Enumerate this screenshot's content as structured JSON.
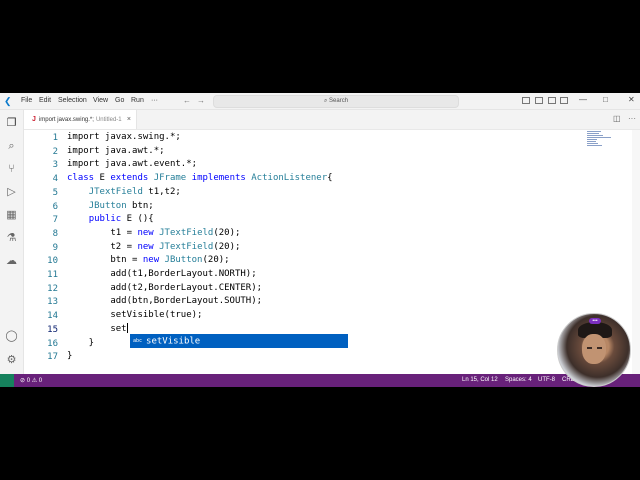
{
  "titlebar": {
    "menu": [
      "File",
      "Edit",
      "Selection",
      "View",
      "Go",
      "Run",
      "···"
    ],
    "nav_back": "←",
    "nav_forward": "→",
    "search_label": "Search",
    "window_controls": [
      "—",
      "□",
      "✕"
    ]
  },
  "tab": {
    "title": "import javax.swing.*;",
    "subtitle": "Untitled-1",
    "close": "×",
    "actions": [
      "◫",
      "···"
    ]
  },
  "editor": {
    "line_numbers": [
      "1",
      "2",
      "3",
      "4",
      "5",
      "6",
      "7",
      "8",
      "9",
      "10",
      "11",
      "12",
      "13",
      "14",
      "15",
      "16",
      "17"
    ],
    "lines": [
      [
        {
          "t": "import javax.swing.*;",
          "c": ""
        }
      ],
      [
        {
          "t": "import java.awt.*;",
          "c": ""
        }
      ],
      [
        {
          "t": "import java.awt.event.*;",
          "c": ""
        }
      ],
      [
        {
          "t": "class",
          "c": "kw"
        },
        {
          "t": " E ",
          "c": ""
        },
        {
          "t": "extends",
          "c": "kw"
        },
        {
          "t": " ",
          "c": ""
        },
        {
          "t": "JFrame",
          "c": "ty"
        },
        {
          "t": " ",
          "c": ""
        },
        {
          "t": "implements",
          "c": "kw"
        },
        {
          "t": " ",
          "c": ""
        },
        {
          "t": "ActionListener",
          "c": "ty"
        },
        {
          "t": "{",
          "c": ""
        }
      ],
      [
        {
          "t": "    ",
          "c": ""
        },
        {
          "t": "JTextField",
          "c": "ty"
        },
        {
          "t": " t1,t2;",
          "c": ""
        }
      ],
      [
        {
          "t": "    ",
          "c": ""
        },
        {
          "t": "JButton",
          "c": "ty"
        },
        {
          "t": " btn;",
          "c": ""
        }
      ],
      [
        {
          "t": "    ",
          "c": ""
        },
        {
          "t": "public",
          "c": "kw"
        },
        {
          "t": " E (){",
          "c": ""
        }
      ],
      [
        {
          "t": "        t1 = ",
          "c": ""
        },
        {
          "t": "new",
          "c": "kw"
        },
        {
          "t": " ",
          "c": ""
        },
        {
          "t": "JTextField",
          "c": "ty"
        },
        {
          "t": "(20);",
          "c": ""
        }
      ],
      [
        {
          "t": "        t2 = ",
          "c": ""
        },
        {
          "t": "new",
          "c": "kw"
        },
        {
          "t": " ",
          "c": ""
        },
        {
          "t": "JTextField",
          "c": "ty"
        },
        {
          "t": "(20);",
          "c": ""
        }
      ],
      [
        {
          "t": "        btn = ",
          "c": ""
        },
        {
          "t": "new",
          "c": "kw"
        },
        {
          "t": " ",
          "c": ""
        },
        {
          "t": "JButton",
          "c": "ty"
        },
        {
          "t": "(20);",
          "c": ""
        }
      ],
      [
        {
          "t": "        add(t1,BorderLayout.NORTH);",
          "c": ""
        }
      ],
      [
        {
          "t": "        add(t2,BorderLayout.CENTER);",
          "c": ""
        }
      ],
      [
        {
          "t": "        add(btn,BorderLayout.SOUTH);",
          "c": ""
        }
      ],
      [
        {
          "t": "        setVisible(true);",
          "c": ""
        }
      ],
      [
        {
          "t": "        set",
          "c": ""
        }
      ],
      [
        {
          "t": "    }",
          "c": ""
        }
      ],
      [
        {
          "t": "}",
          "c": ""
        }
      ]
    ],
    "current_line": 15
  },
  "suggestion": {
    "kind_icon": "abc",
    "label": "setVisible"
  },
  "statusbar": {
    "errors": "⊘ 0 ⚠ 0",
    "position": "Ln 15, Col 12",
    "spaces": "Spaces: 4",
    "encoding": "UTF-8",
    "eol": "CRL"
  },
  "colors": {
    "statusbar": "#68217a",
    "keyword": "#0000ff",
    "type": "#267f99",
    "line_number": "#237893",
    "suggest_highlight": "#0060c0"
  }
}
